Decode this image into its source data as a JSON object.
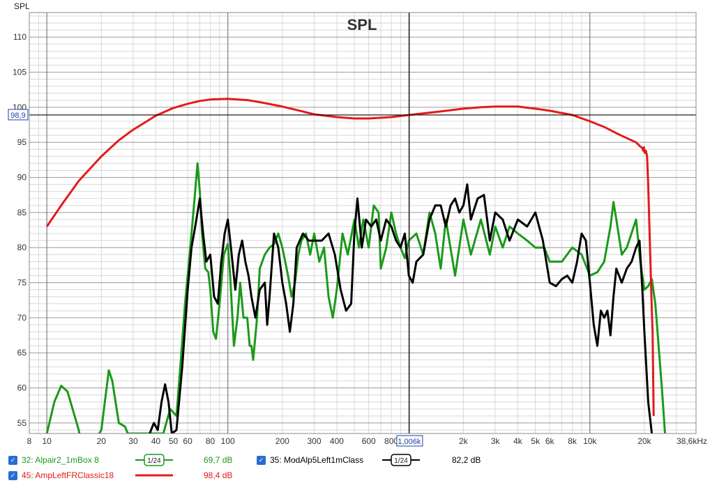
{
  "chart_data": {
    "type": "line",
    "title": "SPL",
    "ylabel": "SPL",
    "xlabel": "",
    "x_scale": "log",
    "xlim": [
      8,
      38600
    ],
    "ylim": [
      53.5,
      113.5
    ],
    "grid": true,
    "y_ticks": [
      55,
      60,
      65,
      70,
      75,
      80,
      85,
      90,
      95,
      100,
      105,
      110
    ],
    "x_ticks": [
      {
        "v": 8,
        "label": "8"
      },
      {
        "v": 10,
        "label": "10"
      },
      {
        "v": 20,
        "label": "20"
      },
      {
        "v": 30,
        "label": "30"
      },
      {
        "v": 40,
        "label": "40"
      },
      {
        "v": 50,
        "label": "50"
      },
      {
        "v": 60,
        "label": "60"
      },
      {
        "v": 80,
        "label": "80"
      },
      {
        "v": 100,
        "label": "100"
      },
      {
        "v": 200,
        "label": "200"
      },
      {
        "v": 300,
        "label": "300"
      },
      {
        "v": 400,
        "label": "400"
      },
      {
        "v": 600,
        "label": "600"
      },
      {
        "v": 800,
        "label": "800"
      },
      {
        "v": 2000,
        "label": "2k"
      },
      {
        "v": 3000,
        "label": "3k"
      },
      {
        "v": 4000,
        "label": "4k"
      },
      {
        "v": 5000,
        "label": "5k"
      },
      {
        "v": 6000,
        "label": "6k"
      },
      {
        "v": 8000,
        "label": "8k"
      },
      {
        "v": 10000,
        "label": "10k"
      },
      {
        "v": 20000,
        "label": "20k"
      },
      {
        "v": 38600,
        "label": "38,6kHz"
      }
    ],
    "cursor": {
      "x": 1006,
      "x_label": "1,006k",
      "y": 98.9,
      "y_label": "98,9"
    },
    "series": [
      {
        "name": "32: Alpair2_1mBox 8",
        "color": "#1a9a1a",
        "points": [
          [
            10,
            53.5
          ],
          [
            11,
            58
          ],
          [
            12,
            60.3
          ],
          [
            13,
            59.5
          ],
          [
            15,
            54
          ],
          [
            16,
            50
          ],
          [
            20,
            54
          ],
          [
            22,
            62.5
          ],
          [
            23,
            61
          ],
          [
            25,
            55
          ],
          [
            27,
            54.5
          ],
          [
            28,
            53.5
          ],
          [
            44,
            53.5
          ],
          [
            48,
            57
          ],
          [
            52,
            56
          ],
          [
            55,
            64
          ],
          [
            58,
            72
          ],
          [
            62,
            80
          ],
          [
            65,
            86
          ],
          [
            68,
            92
          ],
          [
            70,
            88
          ],
          [
            72,
            82
          ],
          [
            75,
            77
          ],
          [
            78,
            76.5
          ],
          [
            80,
            74
          ],
          [
            83,
            68
          ],
          [
            86,
            67
          ],
          [
            90,
            72
          ],
          [
            95,
            79
          ],
          [
            100,
            80.5
          ],
          [
            103,
            76
          ],
          [
            108,
            66
          ],
          [
            113,
            70
          ],
          [
            117,
            75
          ],
          [
            122,
            70
          ],
          [
            128,
            70
          ],
          [
            132,
            66
          ],
          [
            135,
            66
          ],
          [
            138,
            64
          ],
          [
            145,
            70
          ],
          [
            150,
            77
          ],
          [
            160,
            79
          ],
          [
            170,
            80
          ],
          [
            180,
            80.5
          ],
          [
            190,
            82
          ],
          [
            200,
            80
          ],
          [
            215,
            76
          ],
          [
            225,
            73
          ],
          [
            235,
            75
          ],
          [
            245,
            79
          ],
          [
            255,
            81
          ],
          [
            270,
            82
          ],
          [
            285,
            79
          ],
          [
            300,
            82
          ],
          [
            320,
            78
          ],
          [
            340,
            80
          ],
          [
            360,
            73
          ],
          [
            380,
            70
          ],
          [
            400,
            74
          ],
          [
            430,
            82
          ],
          [
            460,
            79
          ],
          [
            500,
            84
          ],
          [
            530,
            80
          ],
          [
            560,
            84
          ],
          [
            600,
            80
          ],
          [
            640,
            86
          ],
          [
            680,
            85
          ],
          [
            700,
            77
          ],
          [
            750,
            80
          ],
          [
            800,
            85
          ],
          [
            850,
            82
          ],
          [
            900,
            80
          ],
          [
            950,
            78.5
          ],
          [
            1000,
            81
          ],
          [
            1100,
            82
          ],
          [
            1200,
            79
          ],
          [
            1300,
            85
          ],
          [
            1400,
            82
          ],
          [
            1500,
            77
          ],
          [
            1600,
            84
          ],
          [
            1800,
            76
          ],
          [
            2000,
            84
          ],
          [
            2200,
            79
          ],
          [
            2500,
            84
          ],
          [
            2800,
            79
          ],
          [
            3000,
            83
          ],
          [
            3300,
            80
          ],
          [
            3600,
            83
          ],
          [
            4000,
            82
          ],
          [
            4500,
            81
          ],
          [
            5000,
            80
          ],
          [
            5600,
            80
          ],
          [
            6000,
            78
          ],
          [
            7000,
            78
          ],
          [
            8000,
            80
          ],
          [
            9000,
            79
          ],
          [
            10000,
            76
          ],
          [
            11000,
            76.5
          ],
          [
            12000,
            78
          ],
          [
            13000,
            83
          ],
          [
            13500,
            86.5
          ],
          [
            14000,
            84
          ],
          [
            15000,
            79
          ],
          [
            16000,
            80
          ],
          [
            18000,
            84
          ],
          [
            19000,
            78
          ],
          [
            20000,
            74
          ],
          [
            21000,
            74.5
          ],
          [
            22000,
            75.5
          ],
          [
            23000,
            72
          ],
          [
            25000,
            60
          ],
          [
            26000,
            53.5
          ]
        ]
      },
      {
        "name": "35: ModAlp5Left1mClass",
        "color": "#000000",
        "points": [
          [
            37,
            53.5
          ],
          [
            39,
            55
          ],
          [
            41,
            54
          ],
          [
            43,
            58
          ],
          [
            45,
            60.5
          ],
          [
            47,
            58
          ],
          [
            49,
            53.5
          ],
          [
            52,
            54
          ],
          [
            56,
            63
          ],
          [
            60,
            74
          ],
          [
            63,
            80
          ],
          [
            66,
            83
          ],
          [
            70,
            87
          ],
          [
            73,
            82
          ],
          [
            76,
            78
          ],
          [
            80,
            79
          ],
          [
            84,
            73
          ],
          [
            88,
            72
          ],
          [
            92,
            78
          ],
          [
            96,
            82
          ],
          [
            100,
            84
          ],
          [
            104,
            80
          ],
          [
            110,
            74
          ],
          [
            115,
            79
          ],
          [
            120,
            81
          ],
          [
            125,
            78
          ],
          [
            130,
            76
          ],
          [
            135,
            73
          ],
          [
            142,
            70
          ],
          [
            150,
            74
          ],
          [
            160,
            75
          ],
          [
            165,
            69
          ],
          [
            170,
            73
          ],
          [
            180,
            82
          ],
          [
            190,
            80
          ],
          [
            200,
            75
          ],
          [
            210,
            72
          ],
          [
            220,
            68
          ],
          [
            230,
            72
          ],
          [
            240,
            80
          ],
          [
            260,
            82
          ],
          [
            280,
            81
          ],
          [
            300,
            81
          ],
          [
            330,
            81
          ],
          [
            360,
            82
          ],
          [
            390,
            79
          ],
          [
            420,
            74
          ],
          [
            450,
            71
          ],
          [
            480,
            72
          ],
          [
            500,
            82
          ],
          [
            520,
            87
          ],
          [
            550,
            80
          ],
          [
            580,
            84
          ],
          [
            620,
            83
          ],
          [
            660,
            84
          ],
          [
            700,
            81
          ],
          [
            750,
            84
          ],
          [
            800,
            83
          ],
          [
            850,
            81
          ],
          [
            900,
            80
          ],
          [
            950,
            82
          ],
          [
            1000,
            76
          ],
          [
            1050,
            75
          ],
          [
            1100,
            78
          ],
          [
            1200,
            79
          ],
          [
            1300,
            84
          ],
          [
            1400,
            86
          ],
          [
            1500,
            86
          ],
          [
            1600,
            83
          ],
          [
            1700,
            86
          ],
          [
            1800,
            87
          ],
          [
            1900,
            85
          ],
          [
            2000,
            86
          ],
          [
            2100,
            89
          ],
          [
            2200,
            84
          ],
          [
            2400,
            87
          ],
          [
            2600,
            87.5
          ],
          [
            2800,
            81
          ],
          [
            3000,
            85
          ],
          [
            3300,
            84
          ],
          [
            3600,
            81
          ],
          [
            4000,
            84
          ],
          [
            4500,
            83
          ],
          [
            5000,
            85
          ],
          [
            5500,
            81
          ],
          [
            6000,
            75
          ],
          [
            6500,
            74.5
          ],
          [
            7000,
            75.5
          ],
          [
            7500,
            76
          ],
          [
            8000,
            75
          ],
          [
            8500,
            78
          ],
          [
            9000,
            82
          ],
          [
            9500,
            81
          ],
          [
            10000,
            75
          ],
          [
            10500,
            69
          ],
          [
            11000,
            66
          ],
          [
            11500,
            71
          ],
          [
            12000,
            70
          ],
          [
            12500,
            71
          ],
          [
            13000,
            67.5
          ],
          [
            13500,
            73
          ],
          [
            14000,
            77
          ],
          [
            15000,
            75
          ],
          [
            16000,
            77
          ],
          [
            17000,
            78
          ],
          [
            18000,
            80
          ],
          [
            18800,
            81
          ],
          [
            19500,
            74
          ],
          [
            20000,
            68
          ],
          [
            21000,
            58
          ],
          [
            22000,
            53.5
          ]
        ]
      },
      {
        "name": "45: AmpLeftFRClassic18",
        "color": "#e41a1a",
        "points": [
          [
            10,
            83
          ],
          [
            12,
            86
          ],
          [
            15,
            89.5
          ],
          [
            20,
            93
          ],
          [
            25,
            95.3
          ],
          [
            30,
            96.8
          ],
          [
            40,
            98.8
          ],
          [
            50,
            99.9
          ],
          [
            60,
            100.5
          ],
          [
            70,
            100.9
          ],
          [
            80,
            101.1
          ],
          [
            100,
            101.2
          ],
          [
            130,
            101
          ],
          [
            160,
            100.6
          ],
          [
            200,
            100.1
          ],
          [
            250,
            99.5
          ],
          [
            300,
            99
          ],
          [
            400,
            98.6
          ],
          [
            500,
            98.4
          ],
          [
            600,
            98.4
          ],
          [
            800,
            98.6
          ],
          [
            1000,
            98.9
          ],
          [
            1500,
            99.4
          ],
          [
            2000,
            99.8
          ],
          [
            2500,
            100
          ],
          [
            3000,
            100.1
          ],
          [
            4000,
            100.1
          ],
          [
            5000,
            99.8
          ],
          [
            6000,
            99.5
          ],
          [
            8000,
            98.9
          ],
          [
            10000,
            98
          ],
          [
            12000,
            97.2
          ],
          [
            14000,
            96.3
          ],
          [
            16000,
            95.6
          ],
          [
            18000,
            95
          ],
          [
            19000,
            94.4
          ],
          [
            19500,
            94.2
          ],
          [
            19700,
            93.8
          ],
          [
            19900,
            94.3
          ],
          [
            20100,
            93.5
          ],
          [
            20400,
            93.8
          ],
          [
            20700,
            93
          ],
          [
            21000,
            89
          ],
          [
            21500,
            80
          ],
          [
            22000,
            71
          ],
          [
            22200,
            68
          ],
          [
            22500,
            56
          ]
        ]
      }
    ]
  },
  "legend": {
    "items": [
      {
        "label": "32: Alpair2_1mBox 8",
        "smoothing": "1/24",
        "value": "69,7 dB",
        "color": "#1a9a1a"
      },
      {
        "label": "35: ModAlp5Left1mClass",
        "smoothing": "1/24",
        "value": "82,2 dB",
        "color": "#000000"
      },
      {
        "label": "45: AmpLeftFRClassic18",
        "smoothing": "",
        "value": "98,4 dB",
        "color": "#e41a1a"
      }
    ]
  },
  "colors": {
    "grid_major": "#9a9a9a",
    "grid_minor": "#d8d8d8",
    "cursor": "#000000",
    "cursor_label": "#1f3fa8"
  }
}
